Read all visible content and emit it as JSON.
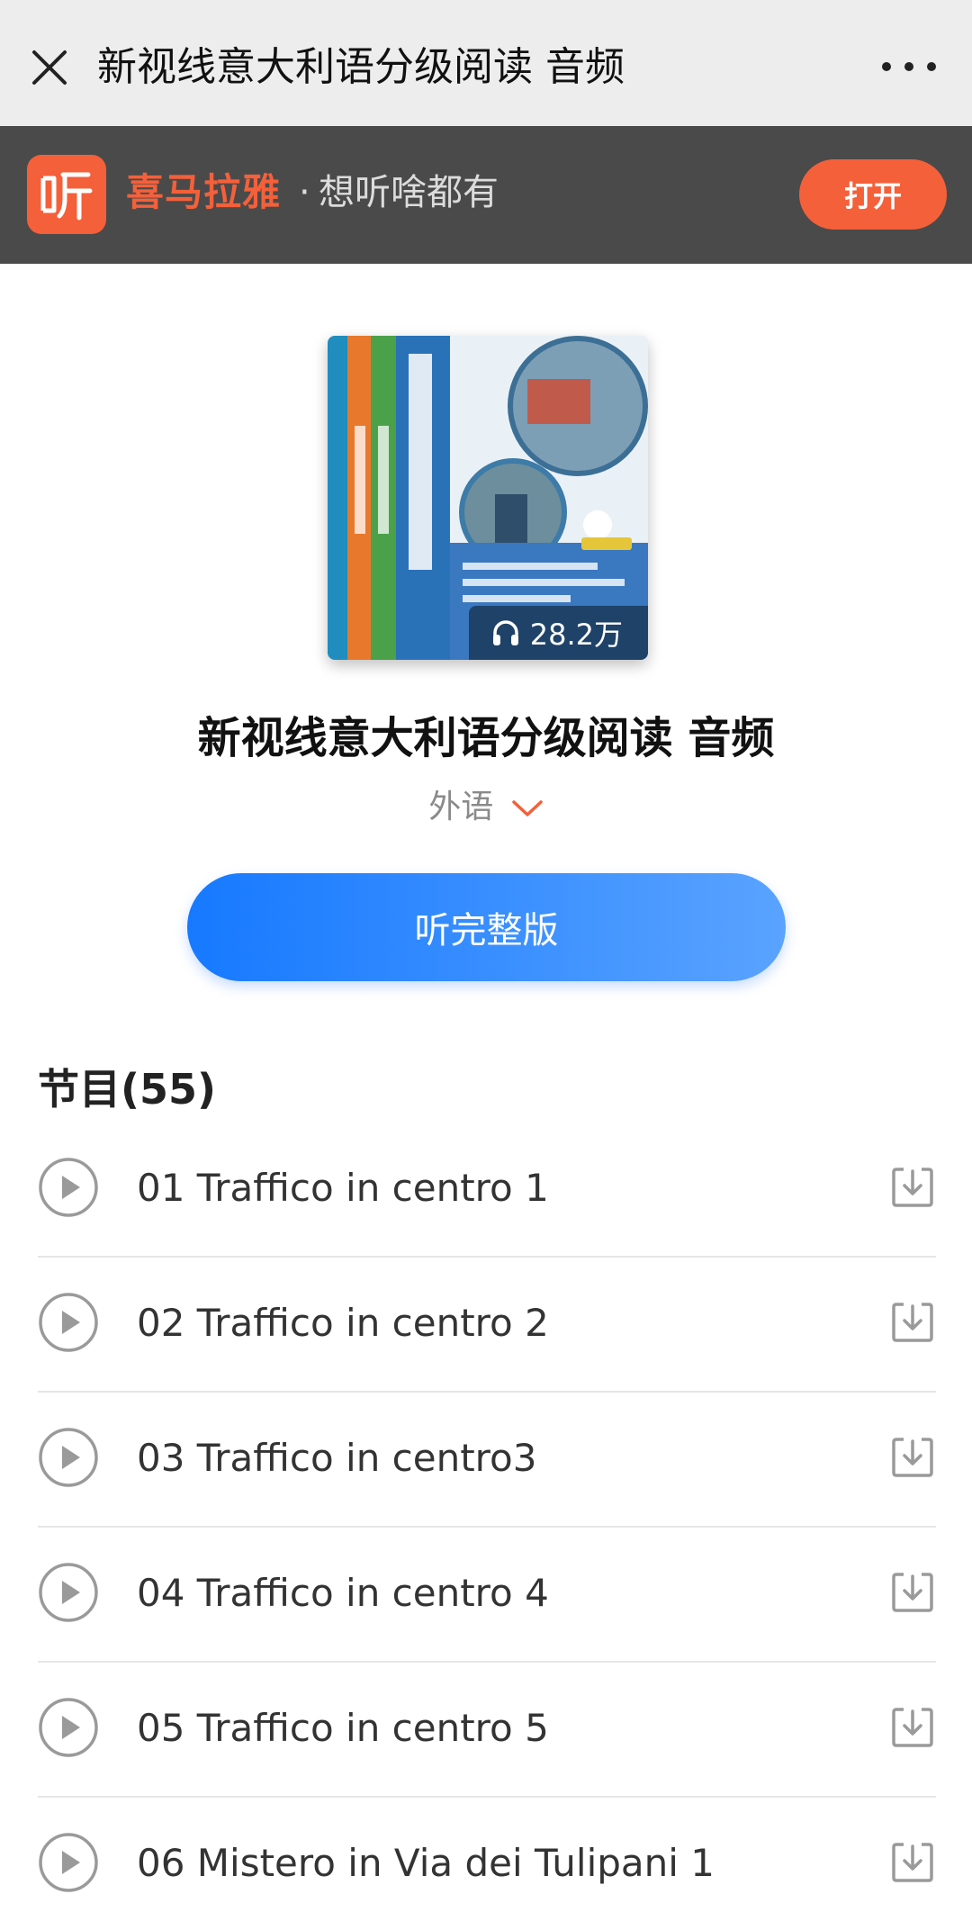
{
  "topbar": {
    "title": "新视线意大利语分级阅读 音频",
    "close_icon": "close-icon",
    "more_icon": "more-icon"
  },
  "banner": {
    "brand": "喜马拉雅",
    "separator": "·",
    "slogan": "想听啥都有",
    "open_label": "打开",
    "accent_color": "#f4603a"
  },
  "album": {
    "play_count": "28.2万",
    "title": "新视线意大利语分级阅读 音频",
    "category": "外语",
    "listen_label": "听完整版",
    "listen_color": "#1679ff"
  },
  "tracks_section": {
    "title": "节目(55)",
    "items": [
      {
        "name": "01 Traffico in centro 1"
      },
      {
        "name": "02 Traffico in centro 2"
      },
      {
        "name": "03 Traffico in centro3"
      },
      {
        "name": "04 Traffico in centro 4"
      },
      {
        "name": "05 Traffico in centro 5"
      },
      {
        "name": "06 Mistero in Via dei Tulipani 1"
      }
    ]
  }
}
